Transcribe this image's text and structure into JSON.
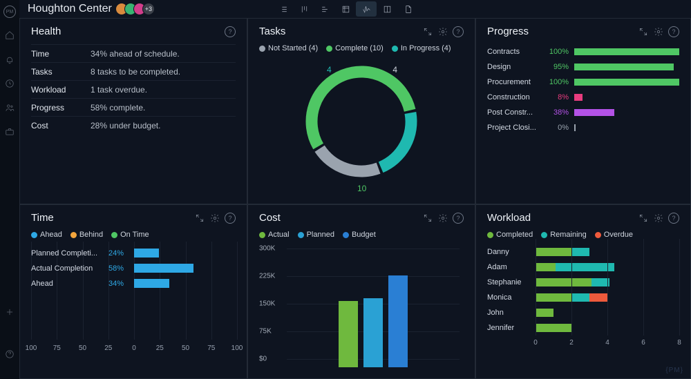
{
  "header": {
    "title": "Houghton Center",
    "avatar_colors": [
      "#d98b3e",
      "#39b372",
      "#d13e8b"
    ],
    "avatar_extra": "+3"
  },
  "viewbar": {
    "active_index": 5
  },
  "rail_icons": [
    "home-icon",
    "bell-icon",
    "clock-icon",
    "team-icon",
    "briefcase-icon"
  ],
  "panels": {
    "health": {
      "title": "Health",
      "rows": [
        {
          "k": "Time",
          "v": "34% ahead of schedule."
        },
        {
          "k": "Tasks",
          "v": "8 tasks to be completed."
        },
        {
          "k": "Workload",
          "v": "1 task overdue."
        },
        {
          "k": "Progress",
          "v": "58% complete."
        },
        {
          "k": "Cost",
          "v": "28% under budget."
        }
      ]
    },
    "tasks": {
      "title": "Tasks",
      "legend": [
        {
          "label": "Not Started (4)",
          "color": "#9aa3ae"
        },
        {
          "label": "Complete (10)",
          "color": "#4fc764"
        },
        {
          "label": "In Progress (4)",
          "color": "#1fb9b0"
        }
      ]
    },
    "progress": {
      "title": "Progress"
    },
    "time": {
      "title": "Time",
      "legend": [
        {
          "label": "Ahead",
          "color": "#2ea8e5"
        },
        {
          "label": "Behind",
          "color": "#f2a53c"
        },
        {
          "label": "On Time",
          "color": "#4fc764"
        }
      ]
    },
    "cost": {
      "title": "Cost",
      "legend": [
        {
          "label": "Actual",
          "color": "#6fb93e"
        },
        {
          "label": "Planned",
          "color": "#2aa1d4"
        },
        {
          "label": "Budget",
          "color": "#2a7fd4"
        }
      ]
    },
    "workload": {
      "title": "Workload",
      "legend": [
        {
          "label": "Completed",
          "color": "#6fb93e"
        },
        {
          "label": "Remaining",
          "color": "#1fb9b0"
        },
        {
          "label": "Overdue",
          "color": "#ee5a3c"
        }
      ]
    }
  },
  "chart_data": [
    {
      "type": "pie",
      "panel": "tasks",
      "series": [
        {
          "name": "Not Started",
          "value": 4,
          "color": "#9aa3ae"
        },
        {
          "name": "Complete",
          "value": 10,
          "color": "#4fc764"
        },
        {
          "name": "In Progress",
          "value": 4,
          "color": "#1fb9b0"
        }
      ],
      "labels_shown": [
        "4",
        "4",
        "10"
      ]
    },
    {
      "type": "bar",
      "panel": "progress",
      "orientation": "horizontal",
      "categories": [
        "Contracts",
        "Design",
        "Procurement",
        "Construction",
        "Post Constr...",
        "Project Closi..."
      ],
      "values": [
        100,
        95,
        100,
        8,
        38,
        0
      ],
      "colors": [
        "#4fc764",
        "#4fc764",
        "#4fc764",
        "#e83c7e",
        "#b352e6",
        "#9aa3ae"
      ],
      "xlim": [
        0,
        100
      ],
      "unit": "%"
    },
    {
      "type": "bar",
      "panel": "time",
      "orientation": "horizontal",
      "categories": [
        "Planned Completi...",
        "Actual Completion",
        "Ahead"
      ],
      "values": [
        24,
        58,
        34
      ],
      "xticks": [
        100,
        75,
        50,
        25,
        0,
        25,
        50,
        75,
        100
      ],
      "color": "#2ea8e5",
      "unit": "%"
    },
    {
      "type": "bar",
      "panel": "cost",
      "categories": [
        "Actual",
        "Planned",
        "Budget"
      ],
      "values": [
        180000,
        188000,
        250000
      ],
      "colors": [
        "#6fb93e",
        "#2aa1d4",
        "#2a7fd4"
      ],
      "ylim": [
        0,
        300000
      ],
      "yticks": [
        "300K",
        "225K",
        "150K",
        "75K",
        "$0"
      ]
    },
    {
      "type": "bar",
      "panel": "workload",
      "orientation": "horizontal",
      "stacked": true,
      "categories": [
        "Danny",
        "Adam",
        "Stephanie",
        "Monica",
        "John",
        "Jennifer"
      ],
      "series": [
        {
          "name": "Completed",
          "color": "#6fb93e",
          "values": [
            2.0,
            1.1,
            3.1,
            2.0,
            1.0,
            2.0
          ]
        },
        {
          "name": "Remaining",
          "color": "#1fb9b0",
          "values": [
            1.0,
            3.3,
            1.0,
            1.0,
            0,
            0
          ]
        },
        {
          "name": "Overdue",
          "color": "#ee5a3c",
          "values": [
            0,
            0,
            0,
            1.0,
            0,
            0
          ]
        }
      ],
      "xticks": [
        0,
        2,
        4,
        6,
        8
      ],
      "xlim": [
        0,
        8
      ]
    }
  ],
  "watermark": "{PM}"
}
